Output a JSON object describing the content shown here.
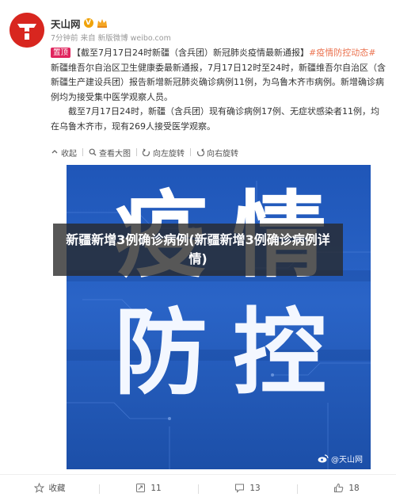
{
  "post": {
    "username": "天山网",
    "vip_badge": "V",
    "meta": "7分钟前 来自 新版微博 weibo.com",
    "top_badge": "置顶",
    "title_text": "【截至7月17日24时新疆（含兵团）新冠肺炎疫情最新通报】",
    "hashtag": "#疫情防控动态#",
    "para1": " 新疆维吾尔自治区卫生健康委最新通报，7月17日12时至24时，新疆维吾尔自治区（含新疆生产建设兵团）报告新增新冠肺炎确诊病例11例，为乌鲁木齐市病例。新增确诊病例均为接受集中医学观察人员。",
    "para2": "截至7月17日24时，新疆（含兵团）现有确诊病例17例、无症状感染者11例，均在乌鲁木齐市，现有269人接受医学观察。"
  },
  "actions": {
    "collapse": "收起",
    "view_large": "查看大图",
    "rotate_left": "向左旋转",
    "rotate_right": "向右旋转"
  },
  "image": {
    "chars": [
      "疫",
      "情",
      "防",
      "控"
    ],
    "watermark": "@天山网",
    "bg_color": "#2a64c7"
  },
  "overlay": {
    "title": "新疆新增3例确诊病例(新疆新增3例确诊病例详情)"
  },
  "footer": {
    "favorite": "收藏",
    "repost_count": "11",
    "comment_count": "13",
    "like_count": "18"
  }
}
